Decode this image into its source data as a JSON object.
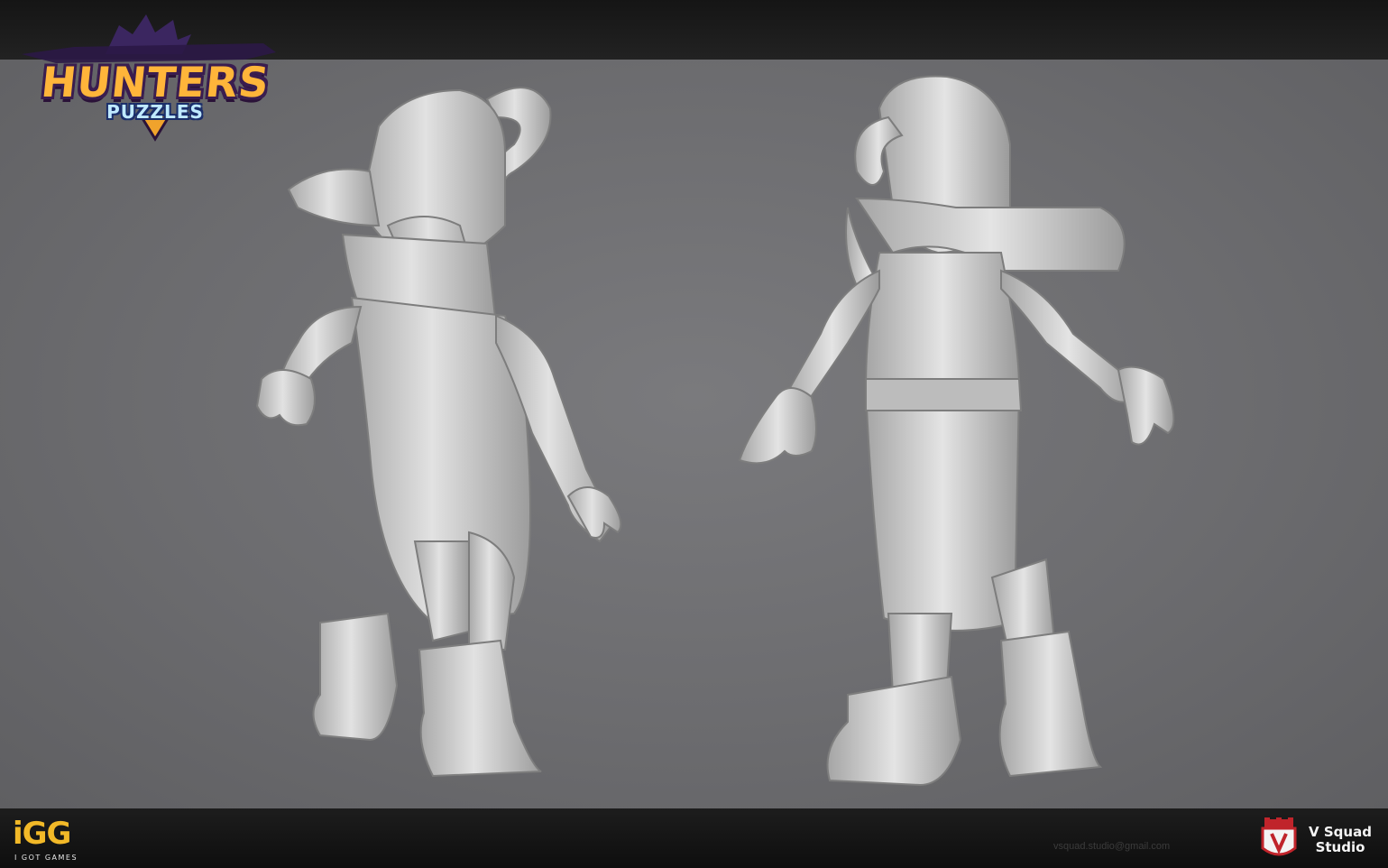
{
  "logo": {
    "title": "HUNTERS",
    "subtitle": "PUZZLES"
  },
  "publisher": {
    "mark": "iGG",
    "name": "I GOT GAMES"
  },
  "footer": {
    "email": "vsquad.studio@gmail.com"
  },
  "studio": {
    "name_line1": "V Squad",
    "name_line2": "Studio"
  },
  "colors": {
    "background": "#6e6e71",
    "bars": "#161616",
    "model": "#cfcfcf",
    "logo_orange": "#ffb53a",
    "logo_blue": "#bfe9ff",
    "publisher_gold": "#f2b928",
    "studio_red": "#c0242b"
  }
}
